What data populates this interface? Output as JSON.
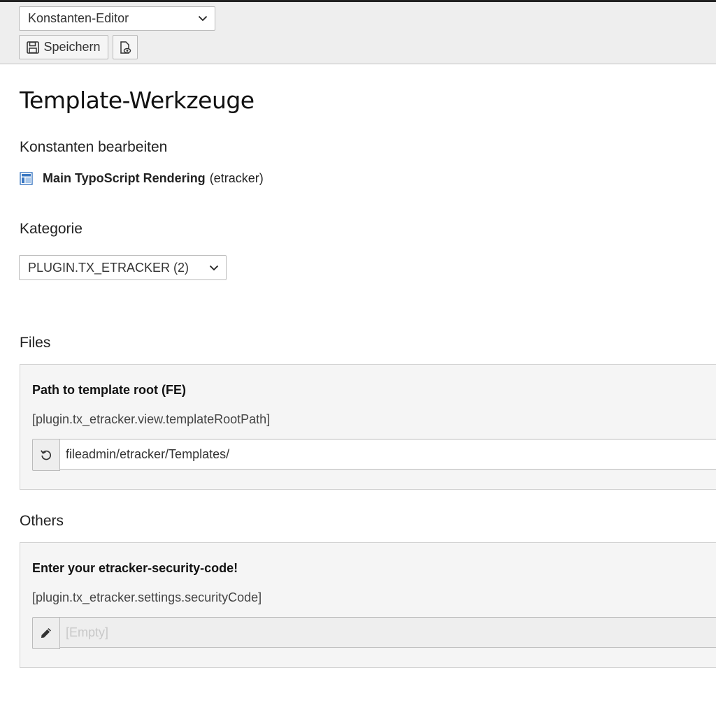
{
  "docheader": {
    "module_select": {
      "selected": "Konstanten-Editor"
    },
    "save_button": {
      "label": "Speichern",
      "icon": "save-icon"
    },
    "view_button": {
      "icon": "document-view-icon"
    }
  },
  "page": {
    "title": "Template-Werkzeuge",
    "subtitle": "Konstanten bearbeiten",
    "template": {
      "icon": "template-icon",
      "name": "Main TypoScript Rendering",
      "identifier": "(etracker)"
    },
    "category": {
      "heading": "Kategorie",
      "selected": "PLUGIN.TX_ETRACKER (2)"
    }
  },
  "sections": [
    {
      "heading": "Files",
      "label": "Path to template root (FE)",
      "key": "[plugin.tx_etracker.view.templateRootPath]",
      "button_icon": "reset-icon",
      "value": "fileadmin/etracker/Templates/"
    },
    {
      "heading": "Others",
      "label": "Enter your etracker-security-code!",
      "key": "[plugin.tx_etracker.settings.securityCode]",
      "button_icon": "pencil-icon",
      "placeholder": "[Empty]"
    }
  ],
  "colors": {
    "accent": "#3b78c2",
    "header_bg": "#eeeeee",
    "panel_bg": "#f5f5f5"
  }
}
